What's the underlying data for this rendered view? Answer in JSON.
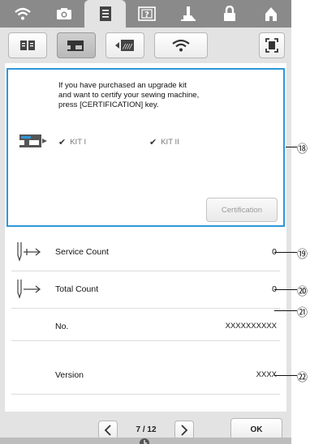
{
  "top_categories": [
    {
      "icon": "wifi-icon",
      "active": false
    },
    {
      "icon": "camera-icon",
      "active": false
    },
    {
      "icon": "document-icon",
      "active": false
    },
    {
      "icon": "help-icon",
      "active": false
    },
    {
      "icon": "presser-foot-icon",
      "active": false
    },
    {
      "icon": "lock-icon",
      "active": false
    },
    {
      "icon": "home-icon",
      "active": false
    }
  ],
  "tabs": [
    {
      "icon": "book-icon",
      "active": false
    },
    {
      "icon": "sewing-machine-icon",
      "active": true
    },
    {
      "icon": "embroidery-frame-icon",
      "active": false
    },
    {
      "icon": "wireless-icon",
      "active": false
    }
  ],
  "kit_panel": {
    "message": "If you have purchased an upgrade kit\nand want to certify your sewing machine,\npress [CERTIFICATION] key.",
    "kit1_label": "KIT I",
    "kit2_label": "KIT II",
    "certification_label": "Certification"
  },
  "info_rows": [
    {
      "label": "Service Count",
      "value": "0"
    },
    {
      "label": "Total Count",
      "value": "0"
    },
    {
      "label": "No.",
      "value": "XXXXXXXXXX"
    },
    {
      "label": "Version",
      "value": "XXXX"
    }
  ],
  "pager": {
    "text": "7 / 12"
  },
  "ok_label": "OK",
  "callouts": [
    "⑱",
    "⑲",
    "⑳",
    "㉑",
    "㉒"
  ],
  "colors": {
    "panel_border": "#2f97d8",
    "topbar": "#8a8a8a"
  }
}
